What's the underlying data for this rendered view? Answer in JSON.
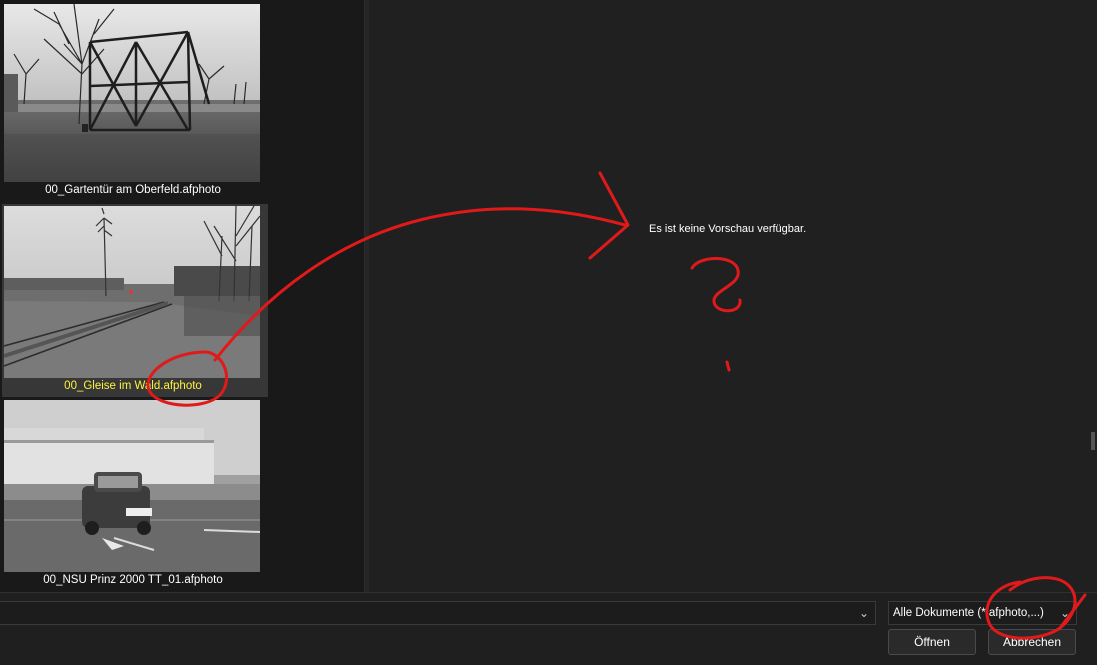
{
  "files": [
    {
      "name": "00_Gartentür am Oberfeld.afphoto",
      "selected": false
    },
    {
      "name": "00_Gleise im Wald.afphoto",
      "selected": true
    },
    {
      "name": "00_NSU Prinz 2000 TT_01.afphoto",
      "selected": false
    }
  ],
  "preview": {
    "message": "Es ist keine Vorschau verfügbar."
  },
  "filename_field": {
    "value": ""
  },
  "filter": {
    "selected": "Alle Dokumente (*.afphoto,...)"
  },
  "buttons": {
    "open": "Öffnen",
    "cancel": "Abbrechen"
  },
  "icons": {
    "dropdown": "chevron-down-icon"
  },
  "colors": {
    "selected_caption": "#fff33c",
    "annotation": "#e01a1a",
    "background": "#202020"
  }
}
